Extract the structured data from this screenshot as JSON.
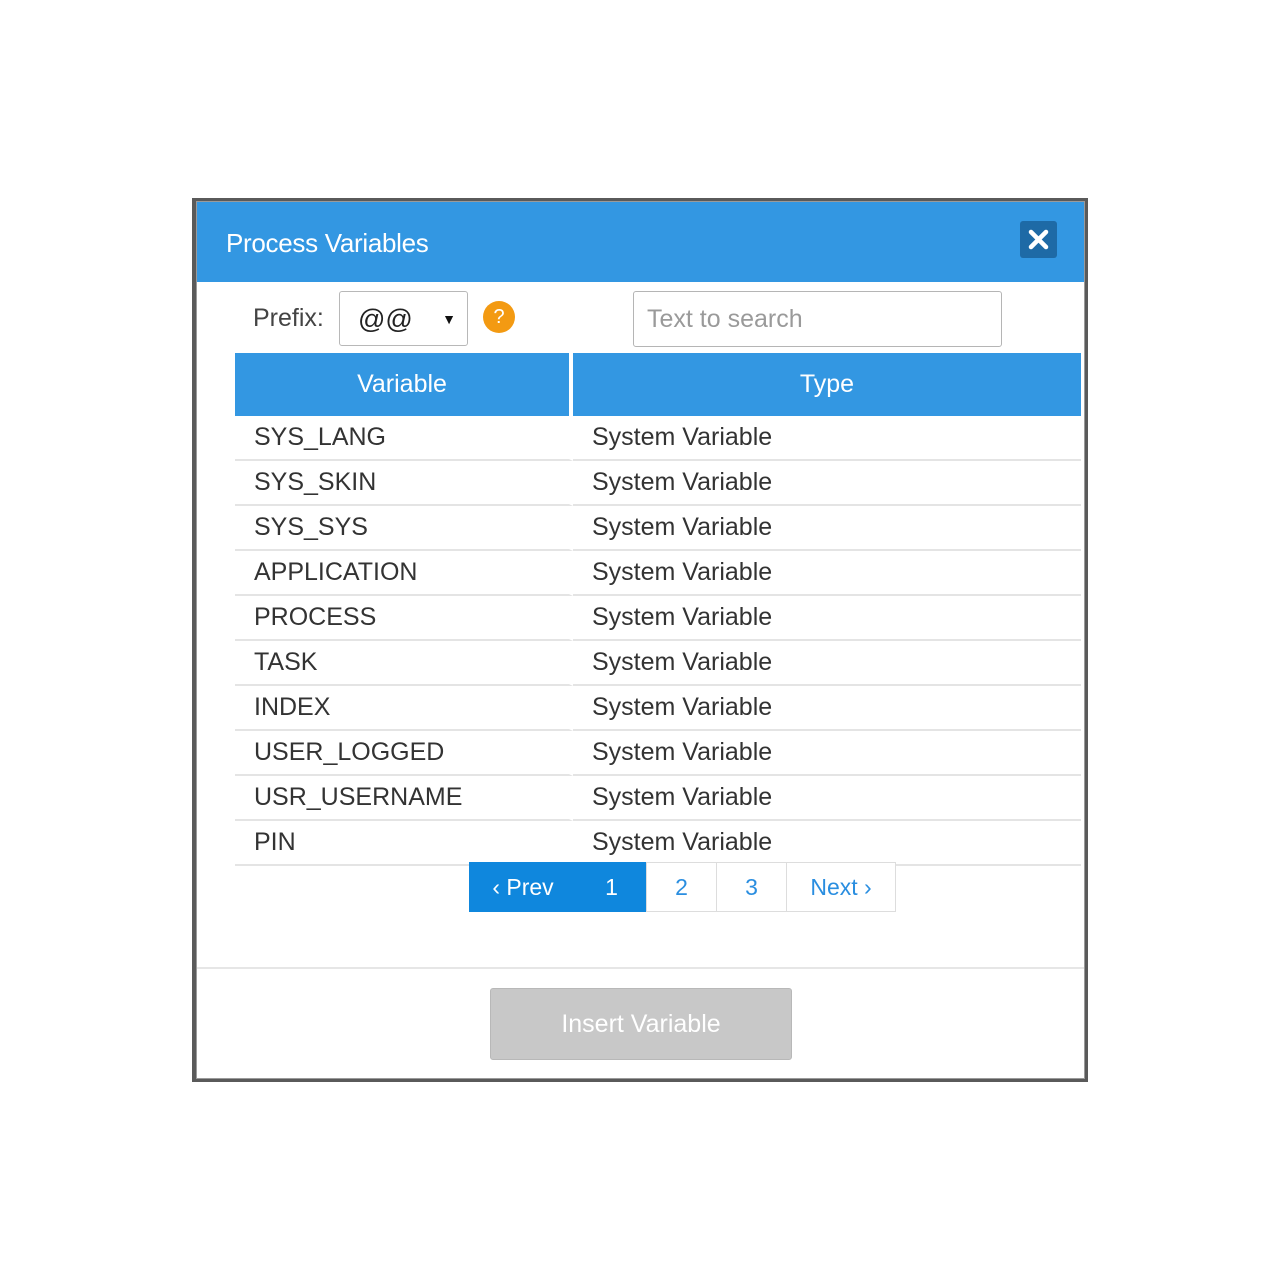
{
  "dialog": {
    "title": "Process Variables"
  },
  "toolbar": {
    "prefix_label": "Prefix:",
    "prefix_value": "@@",
    "help_glyph": "?",
    "search_placeholder": "Text to search",
    "search_value": ""
  },
  "table": {
    "columns": [
      "Variable",
      "Type"
    ],
    "rows": [
      {
        "variable": "SYS_LANG",
        "type": "System Variable"
      },
      {
        "variable": "SYS_SKIN",
        "type": "System Variable"
      },
      {
        "variable": "SYS_SYS",
        "type": "System Variable"
      },
      {
        "variable": "APPLICATION",
        "type": "System Variable"
      },
      {
        "variable": "PROCESS",
        "type": "System Variable"
      },
      {
        "variable": "TASK",
        "type": "System Variable"
      },
      {
        "variable": "INDEX",
        "type": "System Variable"
      },
      {
        "variable": "USER_LOGGED",
        "type": "System Variable"
      },
      {
        "variable": "USR_USERNAME",
        "type": "System Variable"
      },
      {
        "variable": "PIN",
        "type": "System Variable"
      }
    ]
  },
  "pagination": {
    "prev_label": "‹ Prev",
    "pages": [
      "1",
      "2",
      "3"
    ],
    "current_page": "1",
    "next_label": "Next ›"
  },
  "footer": {
    "insert_label": "Insert Variable"
  },
  "colors": {
    "header_blue": "#3397e2",
    "close_button": "#1e6aa6",
    "help_orange": "#f39a12",
    "active_page": "#0f87dd",
    "disabled_button": "#c8c8c8"
  },
  "icons": {
    "close": "close-icon",
    "help": "help-icon",
    "dropdown": "caret-down-icon"
  }
}
